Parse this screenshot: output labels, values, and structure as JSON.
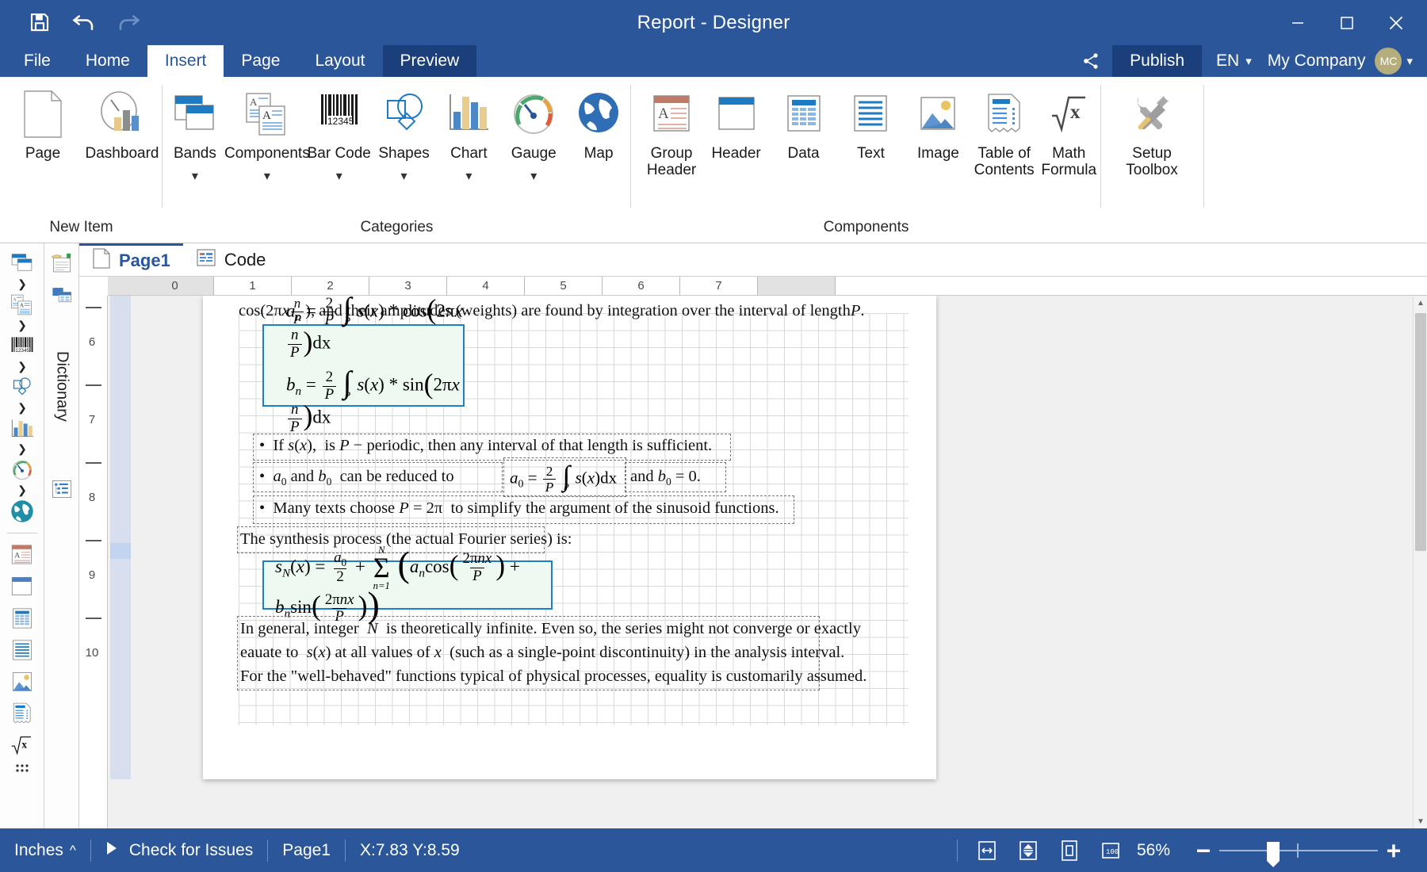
{
  "titlebar": {
    "title": "Report - Designer",
    "quick_access": [
      {
        "name": "save-icon",
        "label": "Save"
      },
      {
        "name": "undo-icon",
        "label": "Undo"
      },
      {
        "name": "redo-icon",
        "label": "Redo"
      }
    ],
    "window_controls": [
      {
        "name": "minimize-icon",
        "glyph": "—"
      },
      {
        "name": "maximize-icon",
        "glyph": "□"
      },
      {
        "name": "close-icon",
        "glyph": "✕"
      }
    ]
  },
  "ribbon": {
    "tabs": [
      {
        "label": "File",
        "state": "normal"
      },
      {
        "label": "Home",
        "state": "normal"
      },
      {
        "label": "Insert",
        "state": "active"
      },
      {
        "label": "Page",
        "state": "normal"
      },
      {
        "label": "Layout",
        "state": "normal"
      },
      {
        "label": "Preview",
        "state": "preview"
      }
    ],
    "right": {
      "share_icon": "share-icon",
      "publish_label": "Publish",
      "language": "EN",
      "company": "My Company",
      "avatar_initials": "MC"
    },
    "groups": [
      {
        "label": "New Item",
        "items": [
          {
            "label": "Page",
            "icon": "page-icon",
            "dropdown": false
          },
          {
            "label": "Dashboard",
            "icon": "dashboard-icon",
            "dropdown": false
          }
        ]
      },
      {
        "label": "Categories",
        "items": [
          {
            "label": "Bands",
            "icon": "bands-icon",
            "dropdown": true
          },
          {
            "label": "Components",
            "icon": "components-icon",
            "dropdown": true
          },
          {
            "label": "Bar Code",
            "icon": "barcode-icon",
            "dropdown": true
          },
          {
            "label": "Shapes",
            "icon": "shapes-icon",
            "dropdown": true
          },
          {
            "label": "Chart",
            "icon": "chart-icon",
            "dropdown": true
          },
          {
            "label": "Gauge",
            "icon": "gauge-icon",
            "dropdown": true
          },
          {
            "label": "Map",
            "icon": "map-icon",
            "dropdown": false
          }
        ]
      },
      {
        "label": "Components",
        "items": [
          {
            "label": "Group Header",
            "icon": "group-header-icon",
            "dropdown": false
          },
          {
            "label": "Header",
            "icon": "header-icon",
            "dropdown": false
          },
          {
            "label": "Data",
            "icon": "data-icon",
            "dropdown": false
          },
          {
            "label": "Text",
            "icon": "text-icon",
            "dropdown": false
          },
          {
            "label": "Image",
            "icon": "image-icon",
            "dropdown": false
          },
          {
            "label": "Table of Contents",
            "icon": "toc-icon",
            "dropdown": false
          },
          {
            "label": "Math Formula",
            "icon": "math-formula-icon",
            "dropdown": false
          }
        ]
      },
      {
        "label": "",
        "items": [
          {
            "label": "Setup Toolbox",
            "icon": "setup-toolbox-icon",
            "dropdown": false
          }
        ]
      }
    ]
  },
  "toolbox": {
    "items": [
      {
        "name": "bands-icon",
        "arrow": true
      },
      {
        "name": "components-icon",
        "arrow": true
      },
      {
        "name": "barcode-icon",
        "arrow": true
      },
      {
        "name": "shapes-icon",
        "arrow": true
      },
      {
        "name": "chart-icon",
        "arrow": true
      },
      {
        "name": "gauge-icon",
        "arrow": true
      },
      {
        "name": "map-icon",
        "arrow": false
      },
      {
        "name": "group-header-icon",
        "arrow": false
      },
      {
        "name": "header-icon",
        "arrow": false
      },
      {
        "name": "data-icon",
        "arrow": false
      },
      {
        "name": "text-icon",
        "arrow": false
      },
      {
        "name": "image-icon",
        "arrow": false
      },
      {
        "name": "toc-icon",
        "arrow": false
      },
      {
        "name": "math-formula-icon",
        "arrow": false
      }
    ],
    "dictionary_label": "Dictionary",
    "dictionary_icons": [
      "dictionary-icon",
      "data-sources-icon",
      "structure-tree-icon"
    ]
  },
  "document": {
    "page_tabs": [
      {
        "label": "Page1",
        "icon": "page-icon",
        "active": true
      },
      {
        "label": "Code",
        "icon": "code-icon",
        "active": false
      }
    ],
    "ruler_h": [
      "0",
      "1",
      "2",
      "3",
      "4",
      "5",
      "6",
      "7"
    ],
    "ruler_v": [
      "6",
      "7",
      "8",
      "9",
      "10"
    ],
    "lines": {
      "top_cut": "cos(2πx  ), and their amplitudes (weights) are found by integration over the interval of length  .",
      "bullet1": "If s(x),  is P − periodic, then any interval of that length is sufficient.",
      "bullet2_pre": "a0  and  b0   can be reduced to",
      "bullet2_mid": "and  b0 = 0.",
      "bullet3": "Many texts choose  P = 2π   to simplify the argument of the sinusoid functions.",
      "synthesis": "The synthesis process (the actual Fourier series) is:",
      "para1": "In general, integer   N  is theoretically infinite. Even so, the series might not converge or exactly",
      "para2": "eauate to  s(x) at all values of  x   (such as a single-point discontinuity) in the analysis interval.",
      "para3": "For the \"well-behaved\" functions typical of physical processes, equality is customarily assumed."
    },
    "formulas": {
      "an": "a_n = (2/P) ∫_P s(x) * cos(2πx n/P) dx",
      "bn": "b_n = (2/P) ∫_P s(x) * sin(2πx n/P) dx",
      "a0": "a_0 = (2/P) ∫_P s(x) dx",
      "sN": "s_N(x) = a_0/2 + Σ_{n=1}^{N} ( a_n cos(2πnx/P) + b_n sin(2πnx/P) )"
    }
  },
  "statusbar": {
    "units": "Inches",
    "units_chevron": "^",
    "run_icon": "play-icon",
    "check_label": "Check for Issues",
    "page_label": "Page1",
    "coordinates": "X:7.83 Y:8.59",
    "view_icons": [
      {
        "name": "fit-width-icon"
      },
      {
        "name": "fit-height-icon"
      },
      {
        "name": "single-page-icon"
      },
      {
        "name": "actual-size-icon"
      }
    ],
    "zoom_label": "56%",
    "zoom_minus": "−",
    "zoom_plus": "+"
  },
  "colors": {
    "brand_blue": "#2b579a",
    "dark_blue": "#1a3f7a",
    "accent_blue": "#1d7fc4",
    "formula_bg": "#eefaf1",
    "avatar": "#b5ad7c"
  }
}
